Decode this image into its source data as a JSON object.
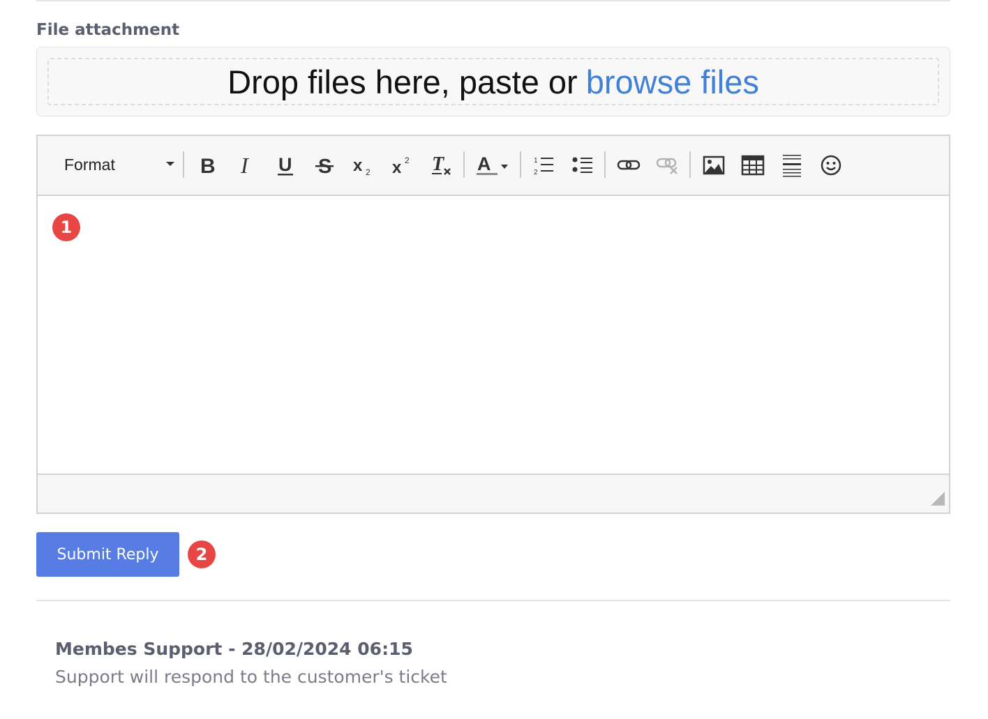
{
  "attachment": {
    "label": "File attachment",
    "drop_text": "Drop files here, paste or",
    "browse_link": "browse files"
  },
  "editor": {
    "format_select": "Format",
    "tools": [
      "bold-icon",
      "italic-icon",
      "underline-icon",
      "strikethrough-icon",
      "subscript-icon",
      "superscript-icon",
      "remove-format-icon",
      "text-color-icon",
      "numbered-list-icon",
      "bulleted-list-icon",
      "link-icon",
      "unlink-icon",
      "image-icon",
      "table-icon",
      "horizontal-line-icon",
      "emoji-icon"
    ],
    "content": ""
  },
  "annotations": {
    "badge_1": "1",
    "badge_2": "2"
  },
  "actions": {
    "submit_label": "Submit Reply"
  },
  "message": {
    "header": "Membes Support - 28/02/2024 06:15",
    "body": "Support will respond to the customer's ticket"
  },
  "colors": {
    "accent": "#577de5",
    "link": "#3f80d8",
    "badge": "#e84545",
    "muted_text": "#5b5e6f"
  }
}
